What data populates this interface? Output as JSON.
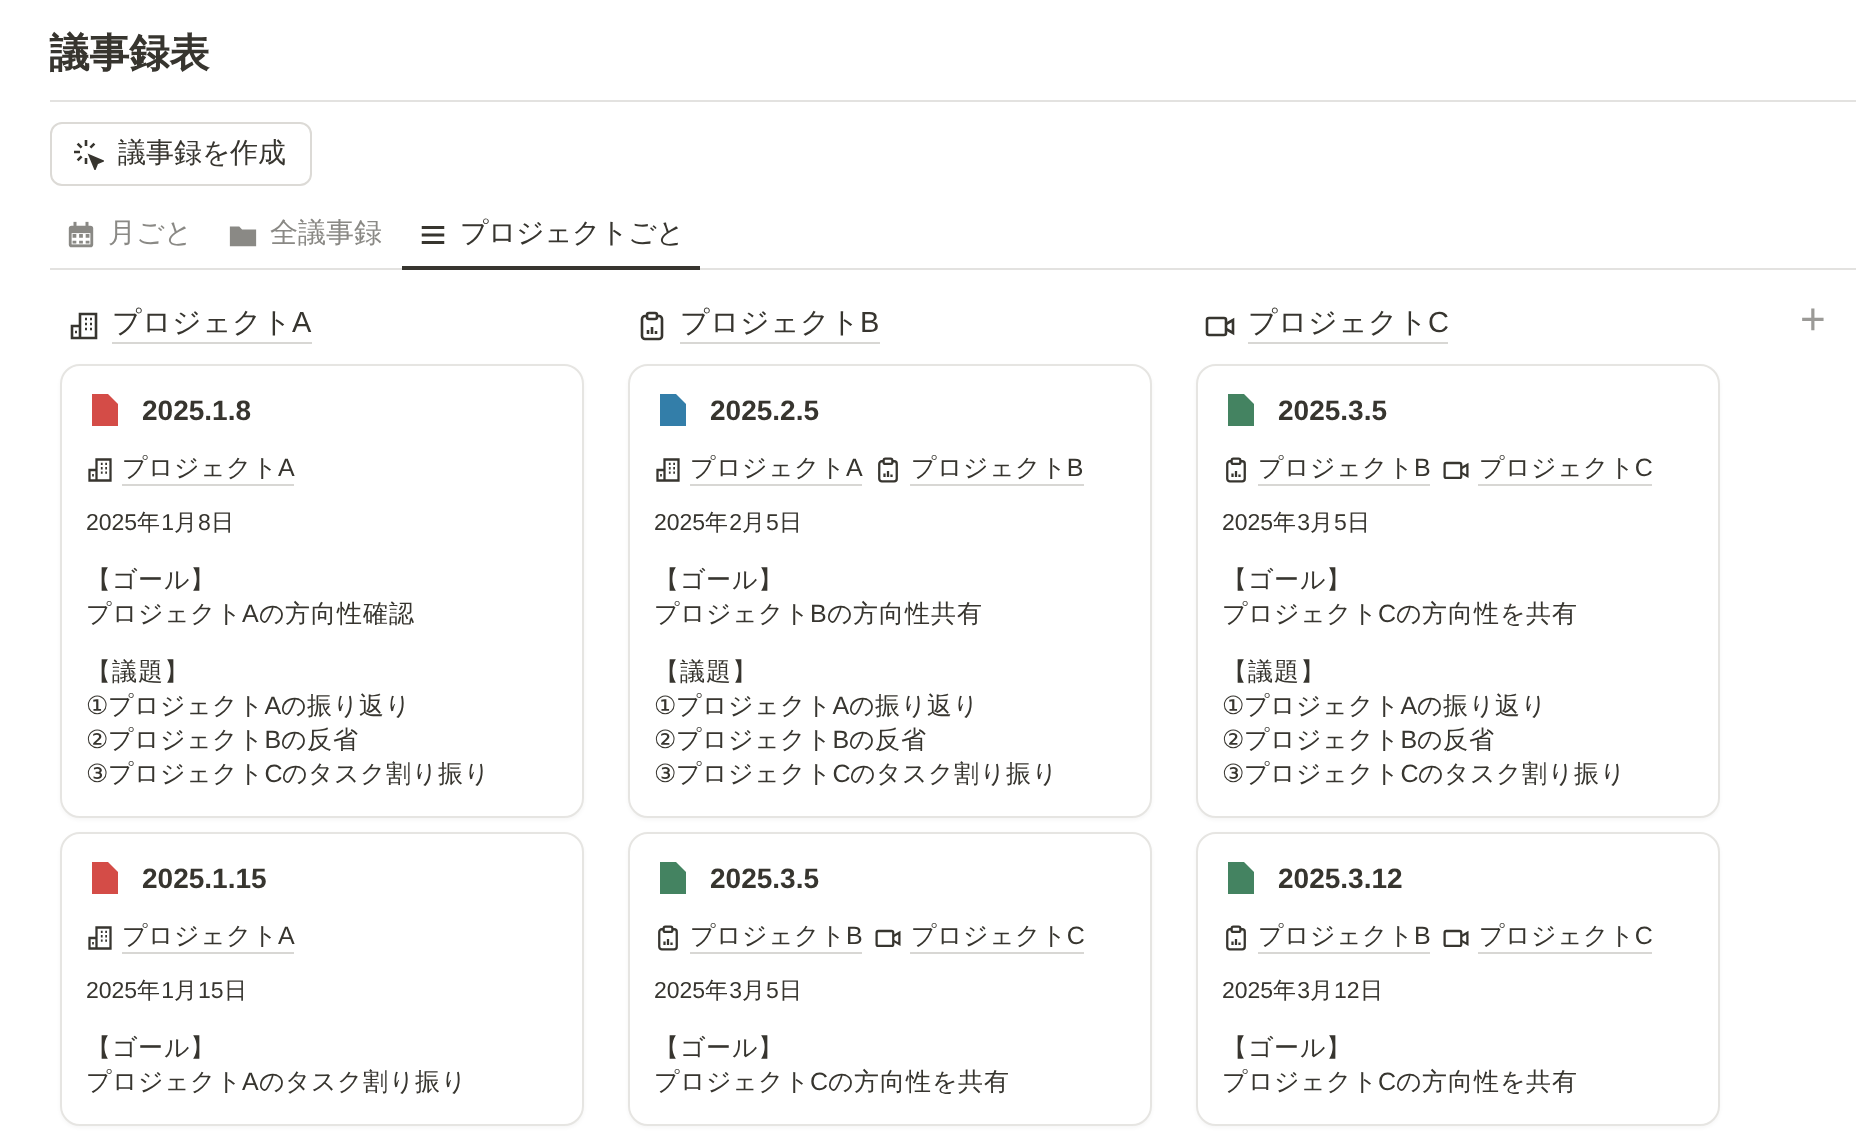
{
  "title": "議事録表",
  "create_button": "議事録を作成",
  "tabs": [
    {
      "label": "月ごと",
      "kind": "calendar",
      "selected": false
    },
    {
      "label": "全議事録",
      "kind": "folder",
      "selected": false
    },
    {
      "label": "プロジェクトごと",
      "kind": "list",
      "selected": true
    }
  ],
  "groups": [
    {
      "name": "プロジェクトA",
      "kind": "building",
      "cards": [
        {
          "title": "2025.1.8",
          "color": "#d44c47",
          "tags": [
            {
              "name": "プロジェクトA",
              "kind": "building"
            }
          ],
          "date": "2025年1月8日",
          "sections": [
            {
              "heading": "【ゴール】",
              "lines": [
                "プロジェクトAの方向性確認"
              ]
            },
            {
              "heading": "【議題】",
              "lines": [
                "①プロジェクトAの振り返り",
                "②プロジェクトBの反省",
                "③プロジェクトCのタスク割り振り"
              ]
            }
          ]
        },
        {
          "title": "2025.1.15",
          "color": "#d44c47",
          "tags": [
            {
              "name": "プロジェクトA",
              "kind": "building"
            }
          ],
          "date": "2025年1月15日",
          "sections": [
            {
              "heading": "【ゴール】",
              "lines": [
                "プロジェクトAのタスク割り振り"
              ]
            }
          ]
        }
      ]
    },
    {
      "name": "プロジェクトB",
      "kind": "clipboard",
      "cards": [
        {
          "title": "2025.2.5",
          "color": "#337ea9",
          "tags": [
            {
              "name": "プロジェクトA",
              "kind": "building"
            },
            {
              "name": "プロジェクトB",
              "kind": "clipboard"
            }
          ],
          "date": "2025年2月5日",
          "sections": [
            {
              "heading": "【ゴール】",
              "lines": [
                "プロジェクトBの方向性共有"
              ]
            },
            {
              "heading": "【議題】",
              "lines": [
                "①プロジェクトAの振り返り",
                "②プロジェクトBの反省",
                "③プロジェクトCのタスク割り振り"
              ]
            }
          ]
        },
        {
          "title": "2025.3.5",
          "color": "#448361",
          "tags": [
            {
              "name": "プロジェクトB",
              "kind": "clipboard"
            },
            {
              "name": "プロジェクトC",
              "kind": "camera"
            }
          ],
          "date": "2025年3月5日",
          "sections": [
            {
              "heading": "【ゴール】",
              "lines": [
                "プロジェクトCの方向性を共有"
              ]
            }
          ]
        }
      ]
    },
    {
      "name": "プロジェクトC",
      "kind": "camera",
      "cards": [
        {
          "title": "2025.3.5",
          "color": "#448361",
          "tags": [
            {
              "name": "プロジェクトB",
              "kind": "clipboard"
            },
            {
              "name": "プロジェクトC",
              "kind": "camera"
            }
          ],
          "date": "2025年3月5日",
          "sections": [
            {
              "heading": "【ゴール】",
              "lines": [
                "プロジェクトCの方向性を共有"
              ]
            },
            {
              "heading": "【議題】",
              "lines": [
                "①プロジェクトAの振り返り",
                "②プロジェクトBの反省",
                "③プロジェクトCのタスク割り振り"
              ]
            }
          ]
        },
        {
          "title": "2025.3.12",
          "color": "#448361",
          "tags": [
            {
              "name": "プロジェクトB",
              "kind": "clipboard"
            },
            {
              "name": "プロジェクトC",
              "kind": "camera"
            }
          ],
          "date": "2025年3月12日",
          "sections": [
            {
              "heading": "【ゴール】",
              "lines": [
                "プロジェクトCの方向性を共有"
              ]
            }
          ]
        }
      ]
    }
  ],
  "add_group": "+"
}
